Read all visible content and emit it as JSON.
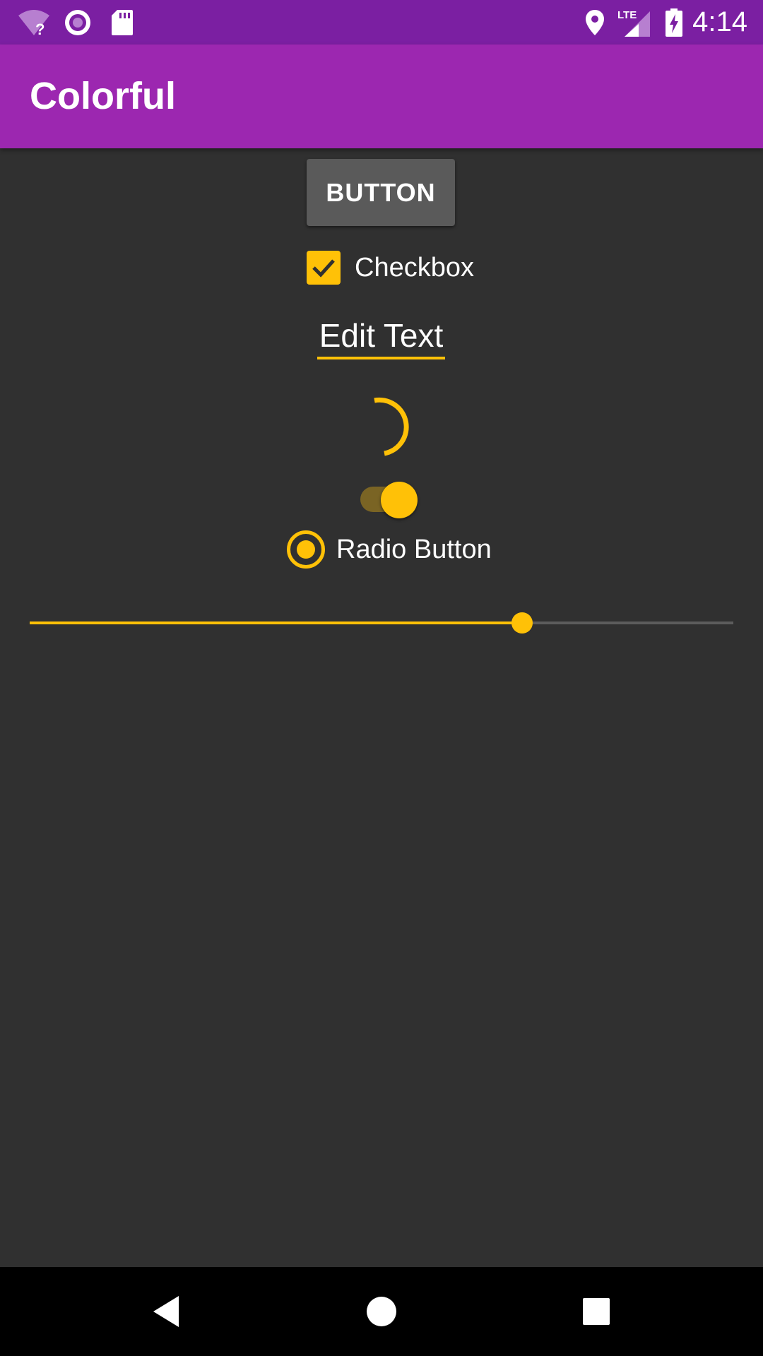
{
  "status_bar": {
    "time": "4:14",
    "icons": [
      "wifi-unknown-icon",
      "sync-circle-icon",
      "sd-card-icon",
      "location-icon",
      "lte-signal-icon",
      "battery-charging-icon"
    ],
    "lte_label": "LTE"
  },
  "app_bar": {
    "title": "Colorful",
    "color": "#9c27b0",
    "status_color": "#7b1fa2"
  },
  "accent_color": "#ffc107",
  "background_color": "#303030",
  "controls": {
    "button_label": "BUTTON",
    "checkbox": {
      "label": "Checkbox",
      "checked": true
    },
    "edit_text": {
      "value": "Edit Text"
    },
    "switch": {
      "on": true
    },
    "radio": {
      "label": "Radio Button",
      "selected": true
    },
    "seekbar": {
      "progress": 0.7
    }
  },
  "nav_bar": {
    "buttons": [
      "back-icon",
      "home-icon",
      "recents-icon"
    ]
  }
}
